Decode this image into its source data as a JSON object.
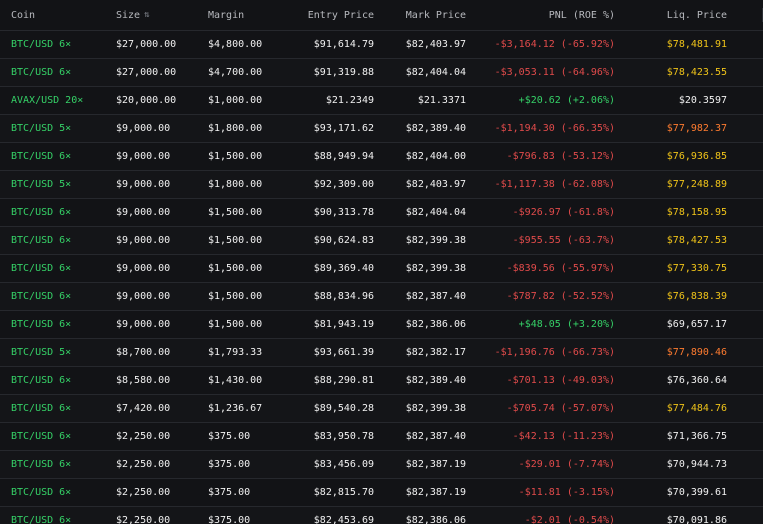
{
  "colors": {
    "background": "#121316",
    "text": "#e6e6e6",
    "green": "#35d167",
    "red": "#e14b4b",
    "yellow": "#f0c419",
    "orange": "#ff7c30"
  },
  "headers": {
    "coin": "Coin",
    "size": "Size",
    "sort_icon": "⇅",
    "margin": "Margin",
    "entry_price": "Entry Price",
    "mark_price": "Mark Price",
    "pnl": "PNL (ROE %)",
    "liq_price": "Liq. Price"
  },
  "rows": [
    {
      "coin": "BTC/USD 6×",
      "size": "$27,000.00",
      "margin": "$4,800.00",
      "entry": "$91,614.79",
      "mark": "$82,403.97",
      "pnl": "-$3,164.12 (-65.92%)",
      "pnl_state": "red",
      "liq": "$78,481.91",
      "liq_state": "yellow"
    },
    {
      "coin": "BTC/USD 6×",
      "size": "$27,000.00",
      "margin": "$4,700.00",
      "entry": "$91,319.88",
      "mark": "$82,404.04",
      "pnl": "-$3,053.11 (-64.96%)",
      "pnl_state": "red",
      "liq": "$78,423.55",
      "liq_state": "yellow"
    },
    {
      "coin": "AVAX/USD 20×",
      "size": "$20,000.00",
      "margin": "$1,000.00",
      "entry": "$21.2349",
      "mark": "$21.3371",
      "pnl": "+$20.62 (+2.06%)",
      "pnl_state": "green",
      "liq": "$20.3597",
      "liq_state": "neutral"
    },
    {
      "coin": "BTC/USD 5×",
      "size": "$9,000.00",
      "margin": "$1,800.00",
      "entry": "$93,171.62",
      "mark": "$82,389.40",
      "pnl": "-$1,194.30 (-66.35%)",
      "pnl_state": "red",
      "liq": "$77,982.37",
      "liq_state": "orange"
    },
    {
      "coin": "BTC/USD 6×",
      "size": "$9,000.00",
      "margin": "$1,500.00",
      "entry": "$88,949.94",
      "mark": "$82,404.00",
      "pnl": "-$796.83 (-53.12%)",
      "pnl_state": "red",
      "liq": "$76,936.85",
      "liq_state": "yellow"
    },
    {
      "coin": "BTC/USD 5×",
      "size": "$9,000.00",
      "margin": "$1,800.00",
      "entry": "$92,309.00",
      "mark": "$82,403.97",
      "pnl": "-$1,117.38 (-62.08%)",
      "pnl_state": "red",
      "liq": "$77,248.89",
      "liq_state": "yellow"
    },
    {
      "coin": "BTC/USD 6×",
      "size": "$9,000.00",
      "margin": "$1,500.00",
      "entry": "$90,313.78",
      "mark": "$82,404.04",
      "pnl": "-$926.97 (-61.8%)",
      "pnl_state": "red",
      "liq": "$78,158.95",
      "liq_state": "yellow"
    },
    {
      "coin": "BTC/USD 6×",
      "size": "$9,000.00",
      "margin": "$1,500.00",
      "entry": "$90,624.83",
      "mark": "$82,399.38",
      "pnl": "-$955.55 (-63.7%)",
      "pnl_state": "red",
      "liq": "$78,427.53",
      "liq_state": "yellow"
    },
    {
      "coin": "BTC/USD 6×",
      "size": "$9,000.00",
      "margin": "$1,500.00",
      "entry": "$89,369.40",
      "mark": "$82,399.38",
      "pnl": "-$839.56 (-55.97%)",
      "pnl_state": "red",
      "liq": "$77,330.75",
      "liq_state": "yellow"
    },
    {
      "coin": "BTC/USD 6×",
      "size": "$9,000.00",
      "margin": "$1,500.00",
      "entry": "$88,834.96",
      "mark": "$82,387.40",
      "pnl": "-$787.82 (-52.52%)",
      "pnl_state": "red",
      "liq": "$76,838.39",
      "liq_state": "yellow"
    },
    {
      "coin": "BTC/USD 6×",
      "size": "$9,000.00",
      "margin": "$1,500.00",
      "entry": "$81,943.19",
      "mark": "$82,386.06",
      "pnl": "+$48.05 (+3.20%)",
      "pnl_state": "green",
      "liq": "$69,657.17",
      "liq_state": "neutral"
    },
    {
      "coin": "BTC/USD 5×",
      "size": "$8,700.00",
      "margin": "$1,793.33",
      "entry": "$93,661.39",
      "mark": "$82,382.17",
      "pnl": "-$1,196.76 (-66.73%)",
      "pnl_state": "red",
      "liq": "$77,890.46",
      "liq_state": "orange"
    },
    {
      "coin": "BTC/USD 6×",
      "size": "$8,580.00",
      "margin": "$1,430.00",
      "entry": "$88,290.81",
      "mark": "$82,389.40",
      "pnl": "-$701.13 (-49.03%)",
      "pnl_state": "red",
      "liq": "$76,360.64",
      "liq_state": "neutral"
    },
    {
      "coin": "BTC/USD 6×",
      "size": "$7,420.00",
      "margin": "$1,236.67",
      "entry": "$89,540.28",
      "mark": "$82,399.38",
      "pnl": "-$705.74 (-57.07%)",
      "pnl_state": "red",
      "liq": "$77,484.76",
      "liq_state": "yellow"
    },
    {
      "coin": "BTC/USD 6×",
      "size": "$2,250.00",
      "margin": "$375.00",
      "entry": "$83,950.78",
      "mark": "$82,387.40",
      "pnl": "-$42.13 (-11.23%)",
      "pnl_state": "red",
      "liq": "$71,366.75",
      "liq_state": "neutral"
    },
    {
      "coin": "BTC/USD 6×",
      "size": "$2,250.00",
      "margin": "$375.00",
      "entry": "$83,456.09",
      "mark": "$82,387.19",
      "pnl": "-$29.01 (-7.74%)",
      "pnl_state": "red",
      "liq": "$70,944.73",
      "liq_state": "neutral"
    },
    {
      "coin": "BTC/USD 6×",
      "size": "$2,250.00",
      "margin": "$375.00",
      "entry": "$82,815.70",
      "mark": "$82,387.19",
      "pnl": "-$11.81 (-3.15%)",
      "pnl_state": "red",
      "liq": "$70,399.61",
      "liq_state": "neutral"
    },
    {
      "coin": "BTC/USD 6×",
      "size": "$2,250.00",
      "margin": "$375.00",
      "entry": "$82,453.69",
      "mark": "$82,386.06",
      "pnl": "-$2.01 (-0.54%)",
      "pnl_state": "red",
      "liq": "$70,091.86",
      "liq_state": "neutral"
    }
  ]
}
